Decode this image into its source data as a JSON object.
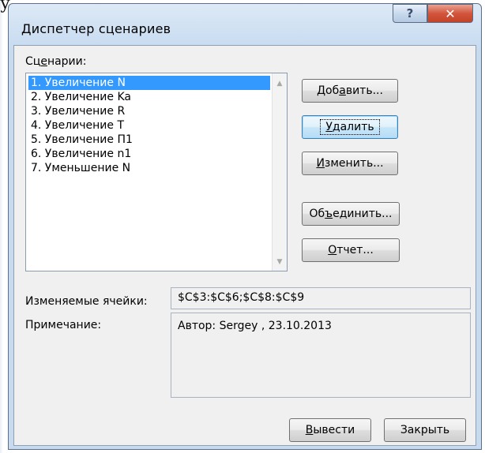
{
  "window": {
    "title": "Диспетчер сценариев",
    "help_glyph": "?",
    "close_glyph": "✕"
  },
  "scenarios": {
    "label_before": "Сц",
    "label_accel": "е",
    "label_after": "нарии:",
    "items": [
      {
        "label": "1. Увеличение N",
        "selected": true
      },
      {
        "label": "2. Увеличение Ka",
        "selected": false
      },
      {
        "label": "3. Увеличение R",
        "selected": false
      },
      {
        "label": "4. Увеличение T",
        "selected": false
      },
      {
        "label": "5. Увеличение П1",
        "selected": false
      },
      {
        "label": "6. Увеличение n1",
        "selected": false
      },
      {
        "label": "7. Уменьшение N",
        "selected": false
      }
    ]
  },
  "buttons": {
    "add_before": "Доб",
    "add_accel": "а",
    "add_after": "вить...",
    "delete_before": "",
    "delete_accel": "У",
    "delete_after": "далить",
    "edit_before": "",
    "edit_accel": "И",
    "edit_after": "зменить...",
    "merge_before": "Об",
    "merge_accel": "ъ",
    "merge_after": "единить...",
    "report_before": "",
    "report_accel": "О",
    "report_after": "тчет...",
    "show_before": "",
    "show_accel": "В",
    "show_after": "ывести",
    "close_label": "Закрыть"
  },
  "details": {
    "changing_cells_label": "Изменяемые ячейки:",
    "changing_cells_value": "$C$3:$C$6;$C$8:$C$9",
    "comment_label": "Примечание:",
    "comment_value": "Автор: Sergey , 23.10.2013"
  },
  "colors": {
    "selection": "#3399ff",
    "close_button": "#c24328",
    "window_frame": "#cddff2"
  }
}
